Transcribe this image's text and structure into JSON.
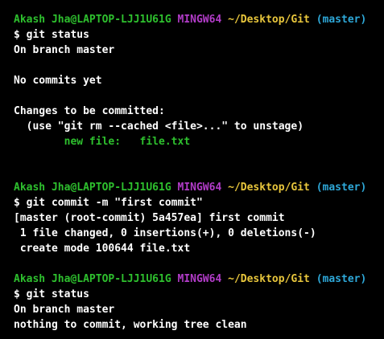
{
  "colors": {
    "background": "#000000",
    "text": "#ffffff",
    "green": "#2ec02e",
    "magenta": "#b23cc8",
    "yellow": "#e8c63c",
    "cyan": "#2ea8d8"
  },
  "prompt": {
    "user_host": "Akash Jha@LAPTOP-LJJ1U61G",
    "system": "MINGW64",
    "path": "~/Desktop/Git",
    "branch": "(master)"
  },
  "blocks": [
    {
      "command": "$ git status",
      "output": [
        "On branch master",
        "",
        "No commits yet",
        "",
        "Changes to be committed:",
        "  (use \"git rm --cached <file>...\" to unstage)"
      ],
      "staged_line": "        new file:   file.txt",
      "trailing_blank_lines": 2
    },
    {
      "command": "$ git commit -m \"first commit\"",
      "output": [
        "[master (root-commit) 5a457ea] first commit",
        " 1 file changed, 0 insertions(+), 0 deletions(-)",
        " create mode 100644 file.txt"
      ],
      "trailing_blank_lines": 1
    },
    {
      "command": "$ git status",
      "output": [
        "On branch master",
        "nothing to commit, working tree clean"
      ]
    }
  ]
}
